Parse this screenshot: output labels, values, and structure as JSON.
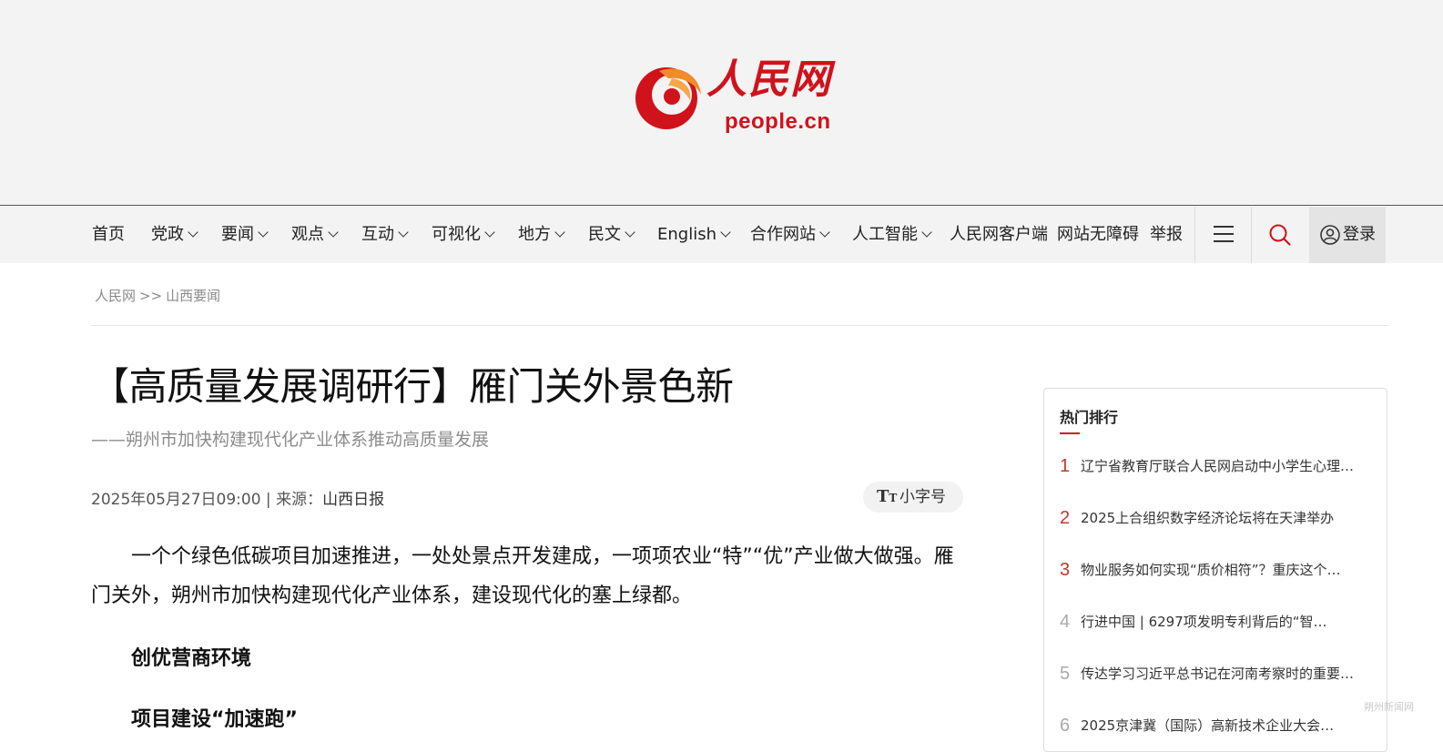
{
  "logo": {
    "cn": "人民网",
    "en": "people.cn",
    "brand_color": "#d0121b",
    "accent_color": "#f08c2a"
  },
  "nav": {
    "items": [
      {
        "label": "首页",
        "dropdown": false
      },
      {
        "label": "党政",
        "dropdown": true
      },
      {
        "label": "要闻",
        "dropdown": true
      },
      {
        "label": "观点",
        "dropdown": true
      },
      {
        "label": "互动",
        "dropdown": true
      },
      {
        "label": "可视化",
        "dropdown": true
      },
      {
        "label": "地方",
        "dropdown": true
      },
      {
        "label": "民文",
        "dropdown": true
      },
      {
        "label": "English",
        "dropdown": true
      },
      {
        "label": "合作网站",
        "dropdown": true
      },
      {
        "label": "人工智能",
        "dropdown": true
      },
      {
        "label": "人民网客户端",
        "dropdown": false
      },
      {
        "label": "网站无障碍",
        "dropdown": false
      },
      {
        "label": "举报",
        "dropdown": false
      }
    ],
    "menu_icon": "hamburger-icon",
    "search_icon": "search-icon",
    "login_label": "登录",
    "login_icon": "user-circle-icon"
  },
  "breadcrumb": {
    "home": "人民网",
    "separator": ">>",
    "section": "山西要闻"
  },
  "article": {
    "title": "【高质量发展调研行】雁门关外景色新",
    "subtitle": "——朔州市加快构建现代化产业体系推动高质量发展",
    "datetime": "2025年05月27日09:00",
    "source_sep": " | ",
    "source_prefix": "来源：",
    "source": "山西日报",
    "font_size_toggle": "小字号",
    "paragraph_1": "一个个绿色低碳项目加速推进，一处处景点开发建成，一项项农业“特”“优”产业做大做强。雁门关外，朔州市加快构建现代化产业体系，建设现代化的塞上绿都。",
    "section_1": "创优营商环境",
    "section_2": "项目建设“加速跑”"
  },
  "hot": {
    "title": "热门排行",
    "items": [
      {
        "rank": "1",
        "text": "辽宁省教育厅联合人民网启动中小学生心理…"
      },
      {
        "rank": "2",
        "text": "2025上合组织数字经济论坛将在天津举办"
      },
      {
        "rank": "3",
        "text": "物业服务如何实现“质价相符”？重庆这个…"
      },
      {
        "rank": "4",
        "text": "行进中国 | 6297项发明专利背后的“智…"
      },
      {
        "rank": "5",
        "text": "传达学习习近平总书记在河南考察时的重要…"
      },
      {
        "rank": "6",
        "text": "2025京津冀（国际）高新技术企业大会…"
      }
    ]
  },
  "watermark": "朔州新闻网"
}
